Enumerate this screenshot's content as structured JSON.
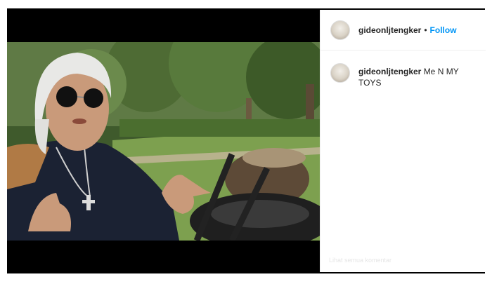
{
  "post": {
    "username": "gideonljtengker",
    "separator": "•",
    "follow_label": "Follow"
  },
  "comment": {
    "username": "gideonljtengker",
    "text": "Me N MY TOYS"
  },
  "footer": {
    "faded_text": "Lihat semua komentar"
  }
}
